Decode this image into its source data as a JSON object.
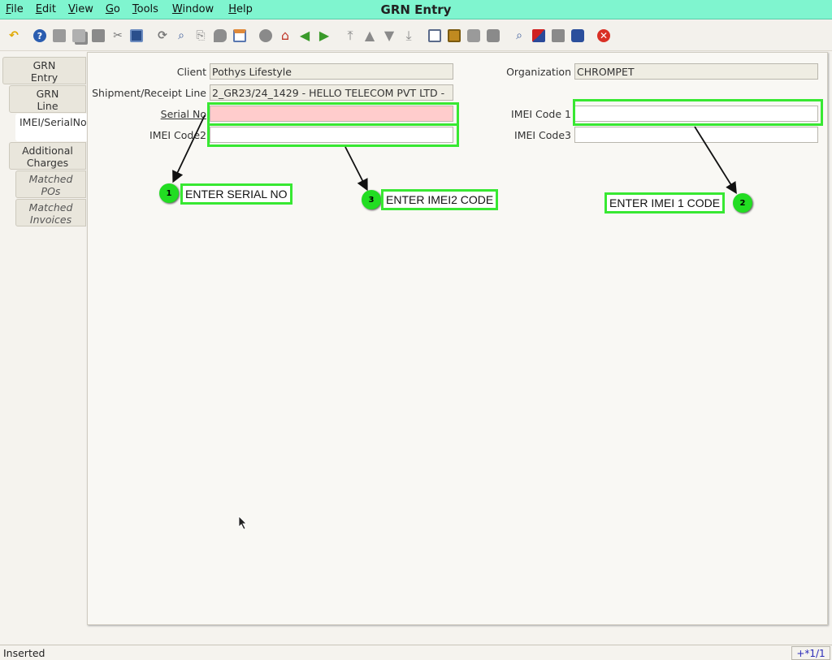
{
  "window": {
    "title": "GRN Entry"
  },
  "menu": {
    "items": [
      {
        "label": "File"
      },
      {
        "label": "Edit"
      },
      {
        "label": "View"
      },
      {
        "label": "Go"
      },
      {
        "label": "Tools"
      },
      {
        "label": "Window"
      },
      {
        "label": "Help"
      }
    ]
  },
  "toolbar": {
    "icons": [
      "undo-icon",
      "help-icon",
      "new-icon",
      "copy-icon",
      "delete-icon",
      "delete-selection-icon",
      "save-icon",
      "refresh-icon",
      "find-icon",
      "attachment-icon",
      "chat-icon",
      "grid-toggle-icon",
      "history-icon",
      "home-icon",
      "parent-icon",
      "detail-icon",
      "first-record-icon",
      "previous-record-icon",
      "next-record-icon",
      "last-record-icon",
      "report-icon",
      "archive-icon",
      "print-preview-icon",
      "print-icon",
      "zoom-across-icon",
      "workflow-icon",
      "request-icon",
      "product-info-icon",
      "close-window-icon"
    ]
  },
  "tabs": [
    {
      "label": "GRN Entry"
    },
    {
      "label": "GRN Line"
    },
    {
      "label": "IMEI/SerialNo"
    },
    {
      "label": "Additional Charges"
    },
    {
      "label": "Matched POs"
    },
    {
      "label": "Matched Invoices"
    }
  ],
  "form": {
    "client_label": "Client",
    "client_value": "Pothys Lifestyle",
    "organization_label": "Organization",
    "organization_value": "CHROMPET",
    "shipment_label": "Shipment/Receipt Line",
    "shipment_value": "2_GR23/24_1429 - HELLO TELECOM PVT LTD -",
    "serial_label": "Serial No",
    "serial_value": "",
    "imei1_label": "IMEI Code 1",
    "imei1_value": "",
    "imei2_label": "IMEI Code2",
    "imei2_value": "",
    "imei3_label": "IMEI Code3",
    "imei3_value": ""
  },
  "annotations": [
    {
      "step": "1",
      "text": "ENTER SERIAL NO"
    },
    {
      "step": "2",
      "text": "ENTER IMEI 1 CODE"
    },
    {
      "step": "3",
      "text": "ENTER IMEI2 CODE"
    }
  ],
  "status": {
    "message": "Inserted",
    "record_indicator": "+*1/1"
  },
  "colors": {
    "titlebar": "#7ff5cf",
    "highlight": "#38e832",
    "mandatory_field": "#ffcccc"
  }
}
